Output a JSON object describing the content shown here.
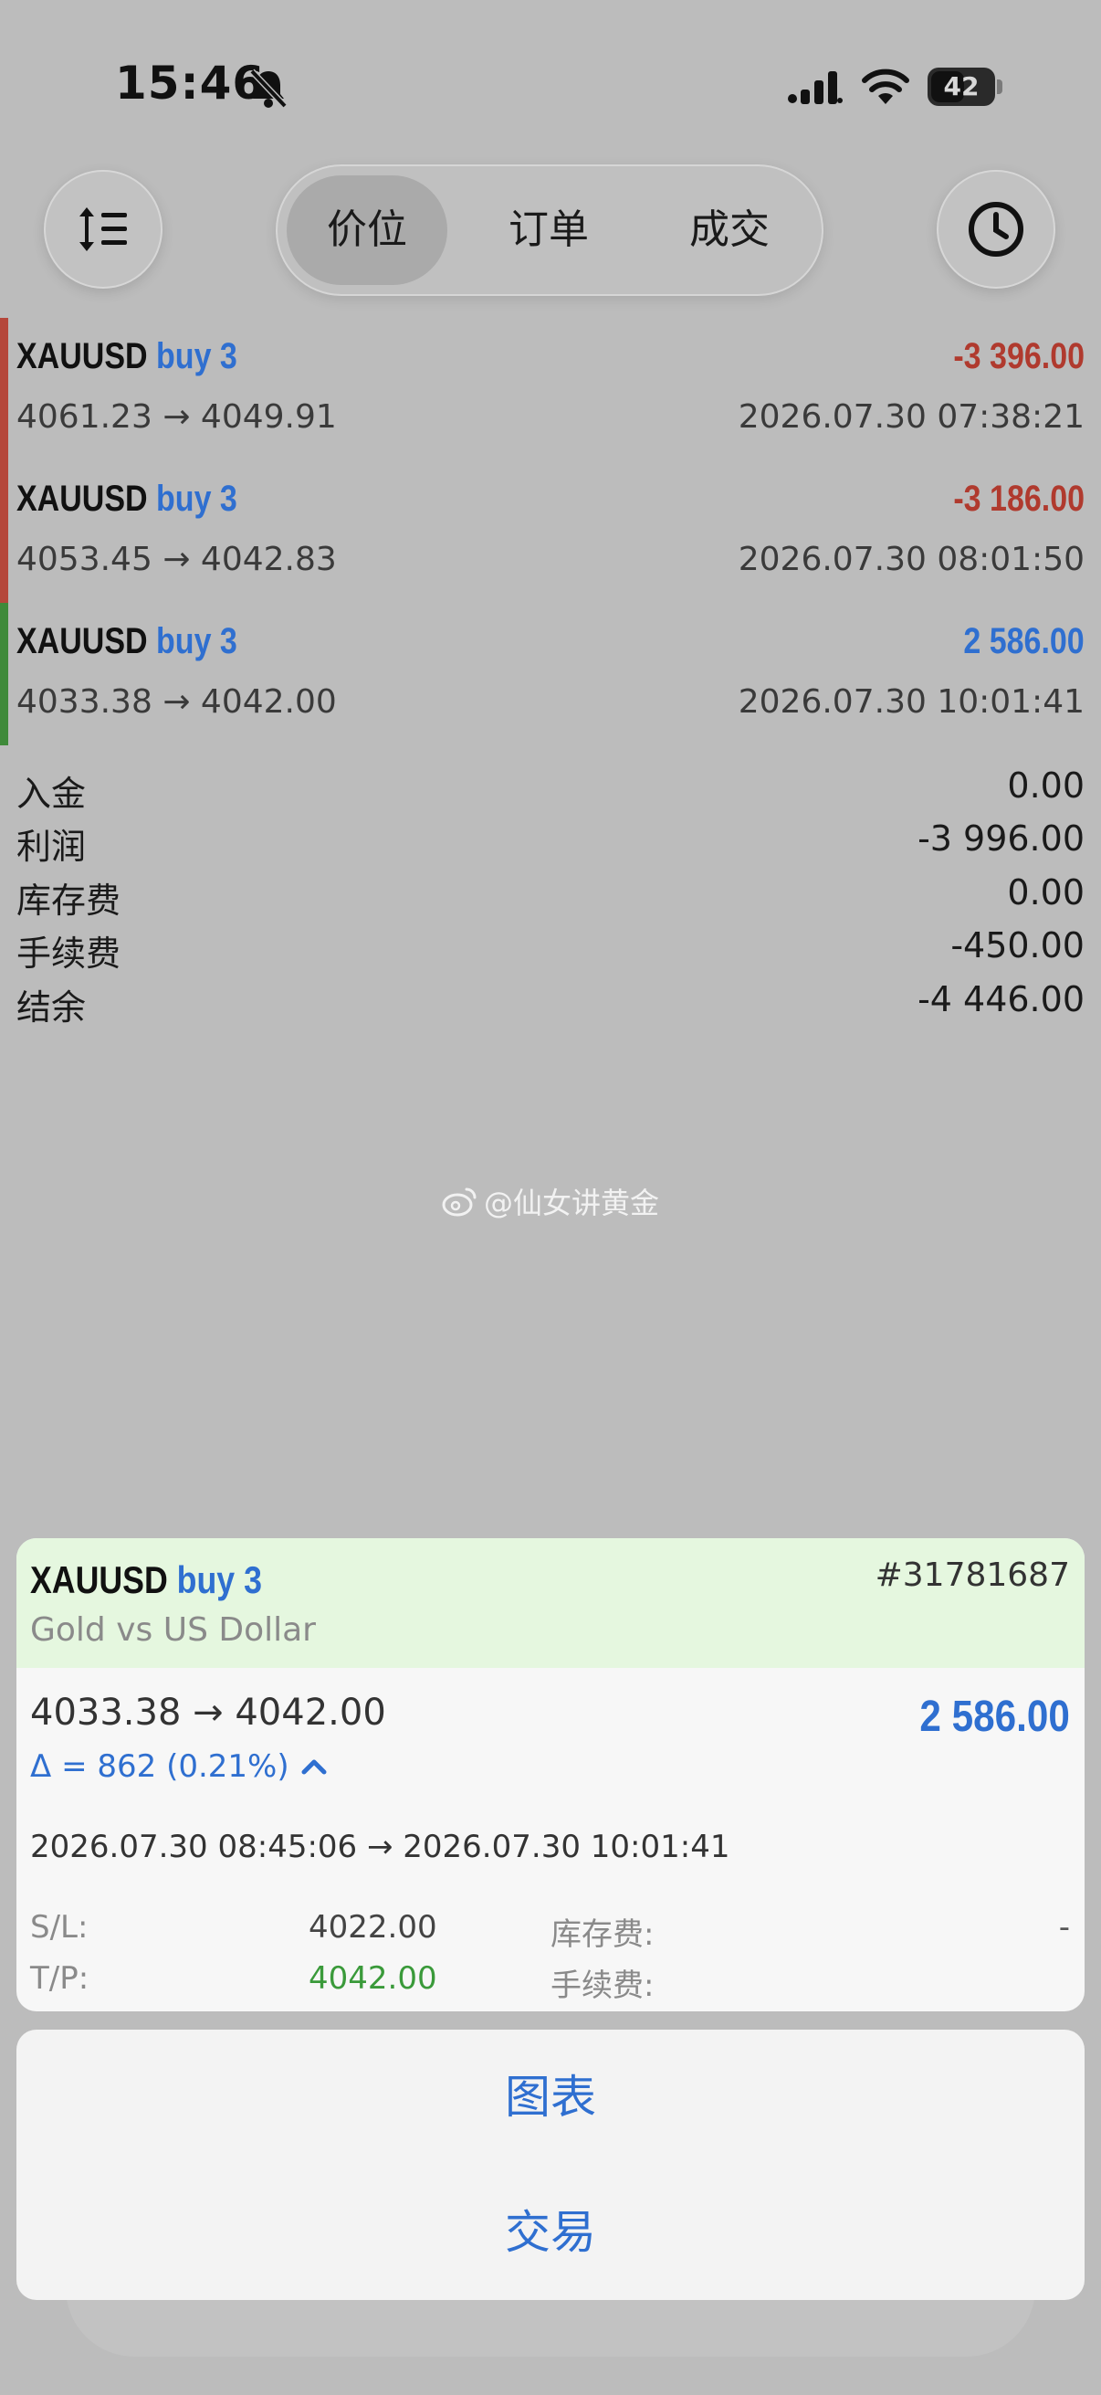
{
  "status_bar": {
    "time": "15:46",
    "battery_level": "42"
  },
  "tabs": [
    {
      "label": "价位",
      "active": true
    },
    {
      "label": "订单",
      "active": false
    },
    {
      "label": "成交",
      "active": false
    }
  ],
  "deals": [
    {
      "symbol": "XAUUSD",
      "side": "buy 3",
      "profit": "-3 396.00",
      "prices": "4061.23 → 4049.91",
      "time": "2026.07.30 07:38:21",
      "color": "#b5473b"
    },
    {
      "symbol": "XAUUSD",
      "side": "buy 3",
      "profit": "-3 186.00",
      "prices": "4053.45 → 4042.83",
      "time": "2026.07.30 08:01:50",
      "color": "#b5473b"
    },
    {
      "symbol": "XAUUSD",
      "side": "buy 3",
      "profit": "2 586.00",
      "prices": "4033.38 → 4042.00",
      "time": "2026.07.30 10:01:41",
      "color": "#3f8a3a"
    }
  ],
  "summary": [
    {
      "label": "入金",
      "value": "0.00"
    },
    {
      "label": "利润",
      "value": "-3 996.00"
    },
    {
      "label": "库存费",
      "value": "0.00"
    },
    {
      "label": "手续费",
      "value": "-450.00"
    },
    {
      "label": "结余",
      "value": "-4 446.00"
    }
  ],
  "watermark": "@仙女讲黄金",
  "detail": {
    "symbol": "XAUUSD",
    "side": "buy 3",
    "order_id": "#31781687",
    "description": "Gold vs US Dollar",
    "prices": "4033.38 → 4042.00",
    "profit": "2 586.00",
    "delta": "Δ = 862 (0.21%)",
    "times": "2026.07.30 08:45:06 → 2026.07.30 10:01:41",
    "sl_label": "S/L:",
    "sl_value": "4022.00",
    "tp_label": "T/P:",
    "tp_value": "4042.00",
    "swap_label": "库存费:",
    "swap_value": "-",
    "commission_label": "手续费:"
  },
  "actions": {
    "chart": "图表",
    "trade": "交易"
  },
  "colors": {
    "accent_blue": "#2f6fd0",
    "loss_red": "#b03a2e",
    "profit_green": "#3f8a3a",
    "header_green": "#e5f7df"
  },
  "icons": [
    "bell-slash-icon",
    "signal-icon",
    "wifi-icon",
    "battery-icon",
    "sort-icon",
    "clock-icon",
    "weibo-icon",
    "chevron-up-icon"
  ]
}
